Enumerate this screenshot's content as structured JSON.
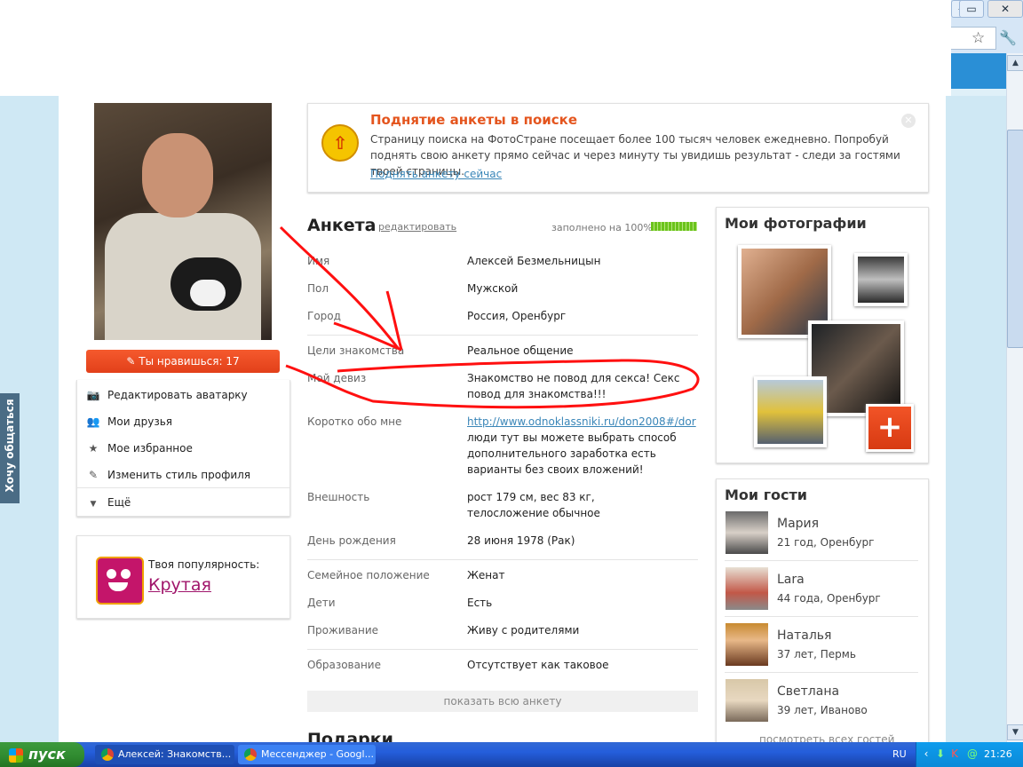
{
  "window": {
    "minimize": "—",
    "restore": "▭",
    "close": "✕"
  },
  "banner": {
    "title": "Поднятие анкеты в поиске",
    "text": "Страницу поиска на ФотоСтране посещает более 100 тысяч человек ежедневно. Попробуй поднять свою анкету прямо сейчас и через минуту ты увидишь результат - следи за гостями твоей страницы.",
    "link": "Поднять анкету сейчас",
    "icon": "arrow-up-icon"
  },
  "left": {
    "like_button": "Ты нравишься: 17",
    "menu": [
      {
        "label": "Редактировать аватарку",
        "icon": "camera-icon"
      },
      {
        "label": "Мои друзья",
        "icon": "friends-icon"
      },
      {
        "label": "Мое избранное",
        "icon": "star-icon"
      },
      {
        "label": "Изменить стиль профиля",
        "icon": "brush-icon"
      },
      {
        "label": "Ещё",
        "icon": "triangle-down-icon"
      }
    ],
    "popularity_label": "Твоя популярность:",
    "popularity_value": "Крутая"
  },
  "side_tab": "Хочу общаться",
  "profile": {
    "title": "Анкета",
    "edit_link": "редактировать",
    "filled": "заполнено на 100%",
    "filled_fraction": 1.0,
    "rows": [
      {
        "label": "Имя",
        "value": "Алексей Безмельницын"
      },
      {
        "label": "Пол",
        "value": "Мужской"
      },
      {
        "label": "Город",
        "value": "Россия, Оренбург"
      },
      {
        "label": "Цели знакомства",
        "value": "Реальное общение"
      },
      {
        "label": "Мой девиз",
        "value": "Знакомство не повод для секса! Секс повод для знакомства!!!"
      },
      {
        "label": "Коротко обо мне",
        "link": "http://www.odnoklassniki.ru/don2008#/dor",
        "value": "люди тут вы можете выбрать способ дополнительного заработка есть варианты без своих вложений!"
      },
      {
        "label": "Внешность",
        "value": "рост 179 см, вес 83 кг, телосложение обычное"
      },
      {
        "label": "День рождения",
        "value": "28 июня 1978 (Рак)"
      },
      {
        "label": "Семейное положение",
        "value": "Женат"
      },
      {
        "label": "Дети",
        "value": "Есть"
      },
      {
        "label": "Проживание",
        "value": "Живу с родителями"
      },
      {
        "label": "Образование",
        "value": "Отсутствует как таковое"
      }
    ],
    "show_all": "показать всю анкету",
    "gifts_title": "Подарки"
  },
  "photos": {
    "title": "Мои фотографии",
    "add_label": "+"
  },
  "guests": {
    "title": "Мои гости",
    "items": [
      {
        "name": "Мария",
        "info": "21 год, Оренбург"
      },
      {
        "name": "Lara",
        "info": "44 года, Оренбург"
      },
      {
        "name": "Наталья",
        "info": "37 лет, Пермь"
      },
      {
        "name": "Светлана",
        "info": "39 лет, Иваново"
      }
    ],
    "all_link": "посмотреть всех гостей"
  },
  "taskbar": {
    "start": "пуск",
    "tasks": [
      "Алексей: Знакомств...",
      "Мессенджер - Googl..."
    ],
    "lang": "RU",
    "clock": "21:26"
  },
  "colors": {
    "accent": "#e4551e",
    "link": "#3a86b8",
    "annotation": "#ff0000"
  }
}
